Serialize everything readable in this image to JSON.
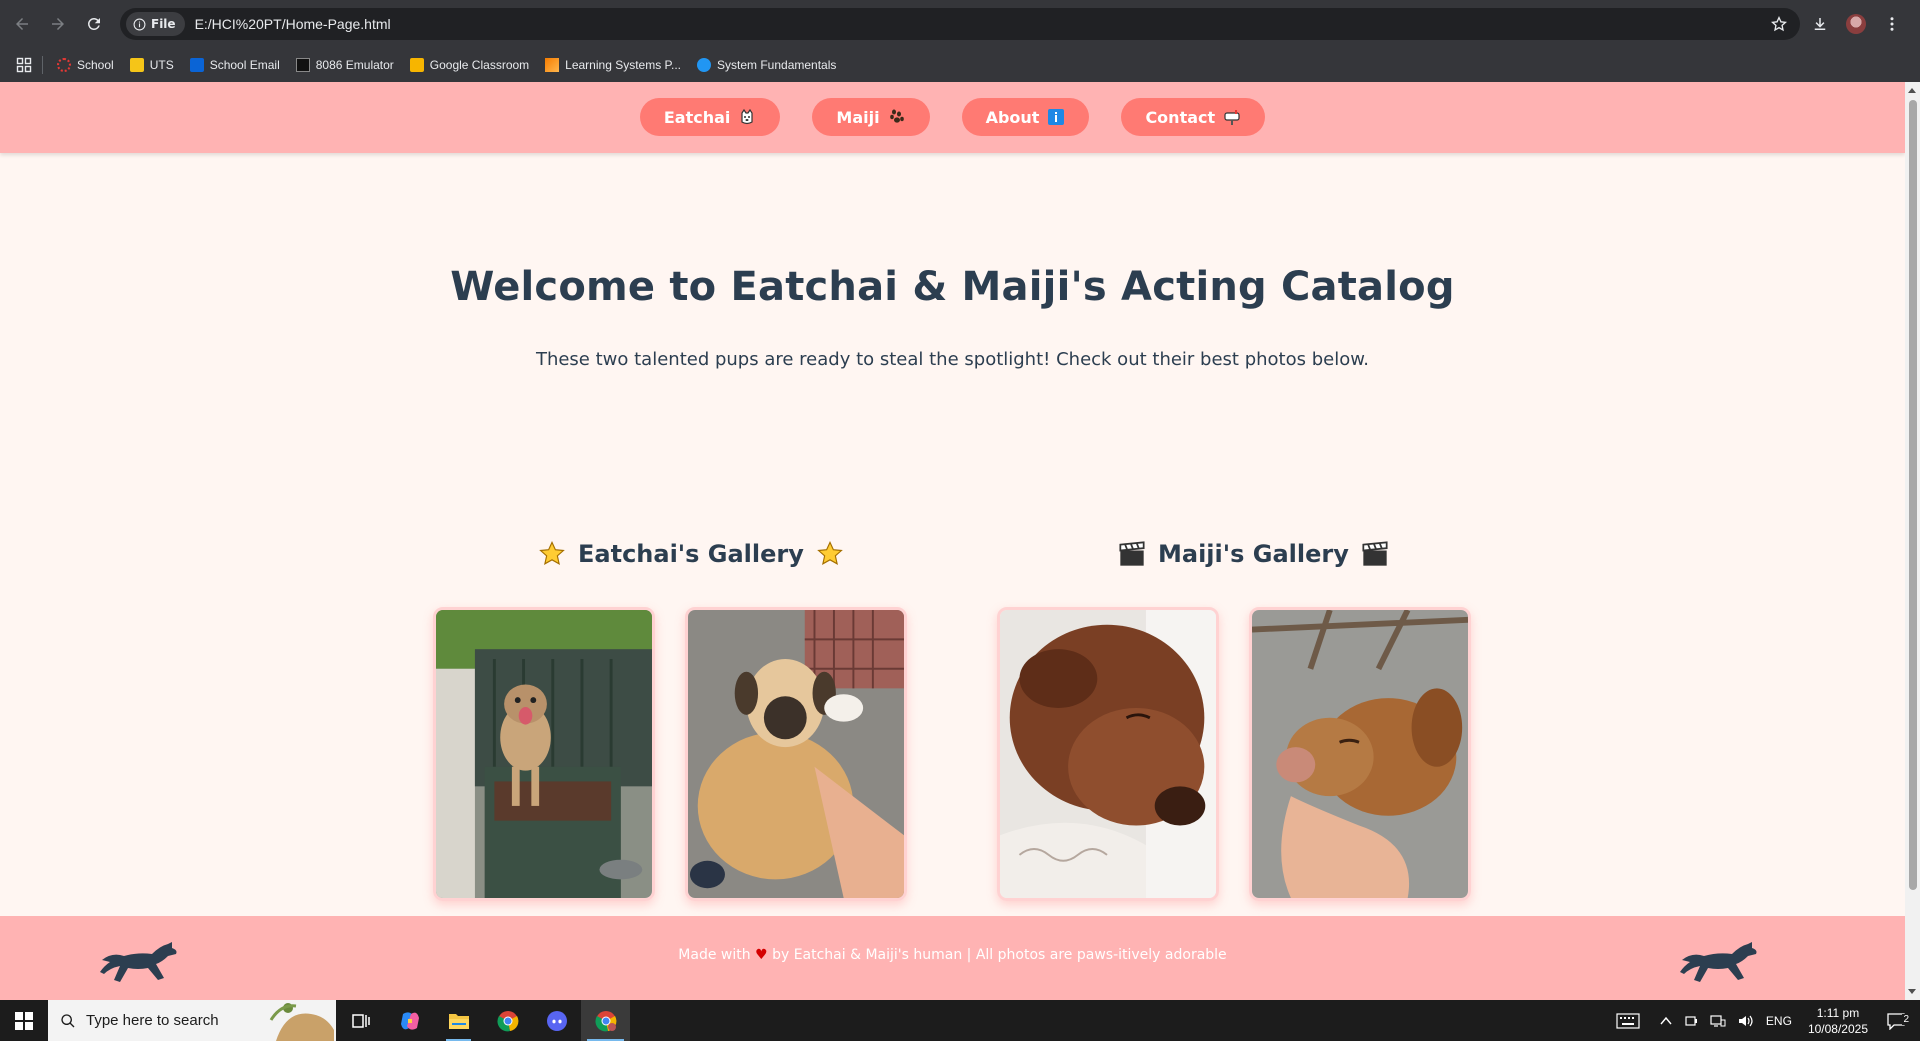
{
  "browser": {
    "site_chip": "File",
    "url": "E:/HCI%20PT/Home-Page.html",
    "bookmarks": [
      {
        "label": "School",
        "icon": "school-icon"
      },
      {
        "label": "UTS",
        "icon": "uts-icon"
      },
      {
        "label": "School Email",
        "icon": "outlook-icon"
      },
      {
        "label": "8086 Emulator",
        "icon": "emulator-icon"
      },
      {
        "label": "Google Classroom",
        "icon": "classroom-icon"
      },
      {
        "label": "Learning Systems P...",
        "icon": "learning-icon"
      },
      {
        "label": "System Fundamentals",
        "icon": "fundamentals-icon"
      }
    ]
  },
  "page": {
    "nav": [
      {
        "label": "Eatchai",
        "icon": "dog-emoji-icon"
      },
      {
        "label": "Maiji",
        "icon": "paw-emoji-icon"
      },
      {
        "label": "About",
        "icon": "info-emoji-icon"
      },
      {
        "label": "Contact",
        "icon": "mailbox-emoji-icon"
      }
    ],
    "hero": {
      "title": "Welcome to Eatchai & Maiji's Acting Catalog",
      "subtitle": "These two talented pups are ready to steal the spotlight! Check out their best photos below."
    },
    "galleries": [
      {
        "title": "Eatchai's Gallery",
        "icon": "star-icon"
      },
      {
        "title": "Maiji's Gallery",
        "icon": "clapperboard-icon"
      }
    ],
    "footer": {
      "made_with": "Made with",
      "rest": "by Eatchai & Maiji's human | All photos are paws-itively adorable"
    }
  },
  "taskbar": {
    "search_placeholder": "Type here to search",
    "tray": {
      "language": "ENG",
      "time": "1:11 pm",
      "date": "10/08/2025",
      "notifications": "2"
    }
  },
  "colors": {
    "header_pink": "#ffb3b3",
    "nav_pill": "#ff7a73",
    "page_bg": "#fff6f2",
    "heading": "#2c3e50"
  }
}
